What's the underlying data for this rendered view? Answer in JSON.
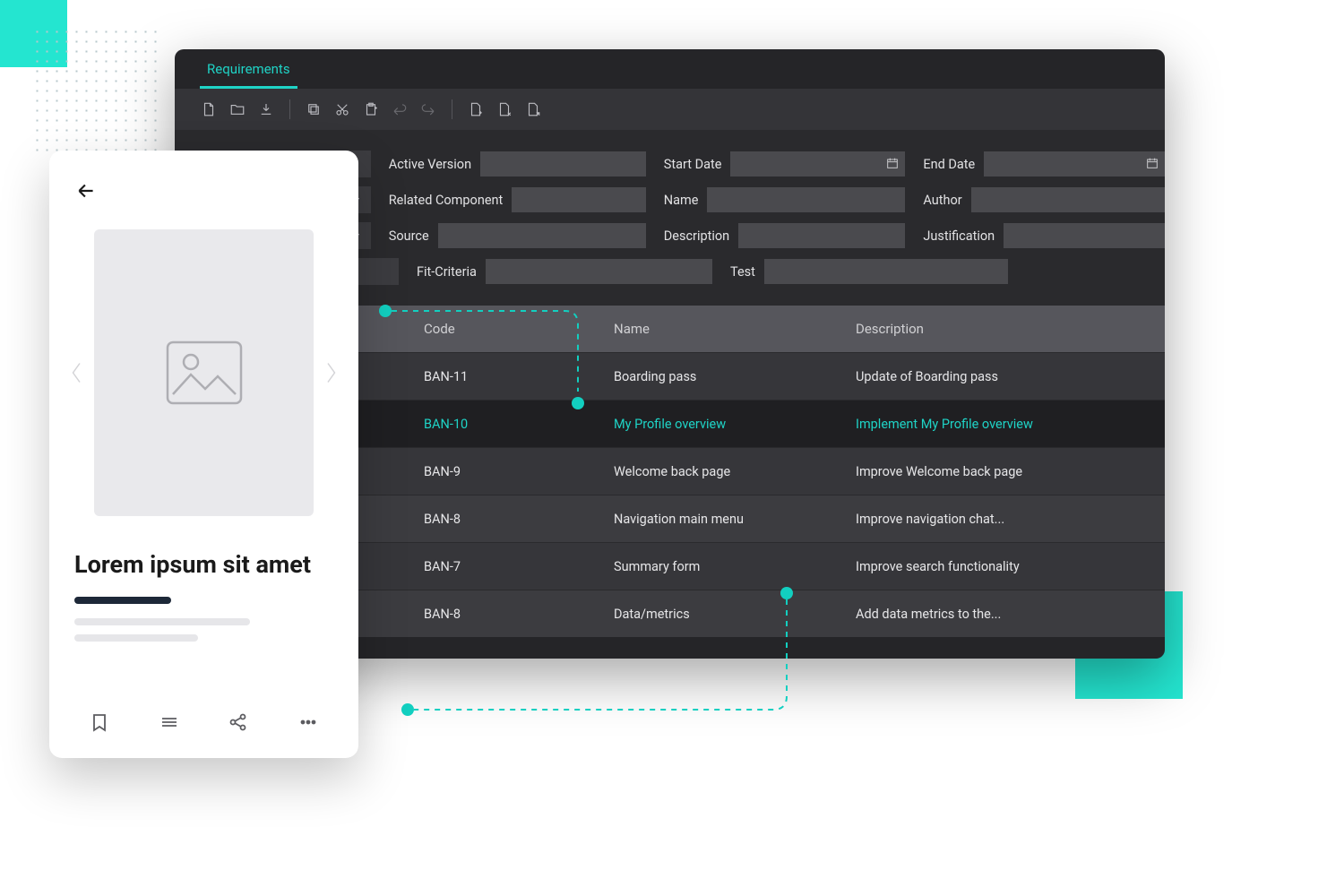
{
  "colors": {
    "accent": "#1fd3c6"
  },
  "app": {
    "tab": "Requirements",
    "fields": {
      "active_version": "Active Version",
      "start_date": "Start Date",
      "end_date": "End Date",
      "related_component": "Related Component",
      "name": "Name",
      "author": "Author",
      "source": "Source",
      "description": "Description",
      "justification": "Justification",
      "fit_criteria": "Fit-Criteria",
      "test": "Test"
    },
    "table": {
      "headers": {
        "code": "Code",
        "name": "Name",
        "description": "Description"
      },
      "rows": [
        {
          "code": "BAN-11",
          "name": "Boarding pass",
          "description": "Update of Boarding pass",
          "active": false
        },
        {
          "code": "BAN-10",
          "name": "My Profile overview",
          "description": "Implement My Profile overview",
          "active": true
        },
        {
          "code": "BAN-9",
          "name": "Welcome back page",
          "description": "Improve Welcome back page",
          "active": false
        },
        {
          "code": "BAN-8",
          "name": "Navigation main menu",
          "description": "Improve navigation chat...",
          "active": false
        },
        {
          "code": "BAN-7",
          "name": "Summary form",
          "description": "Improve search functionality",
          "active": false
        },
        {
          "code": "BAN-8",
          "name": "Data/metrics",
          "description": "Add data metrics to the...",
          "active": false
        }
      ]
    }
  },
  "phone": {
    "title": "Lorem ipsum sit amet"
  }
}
